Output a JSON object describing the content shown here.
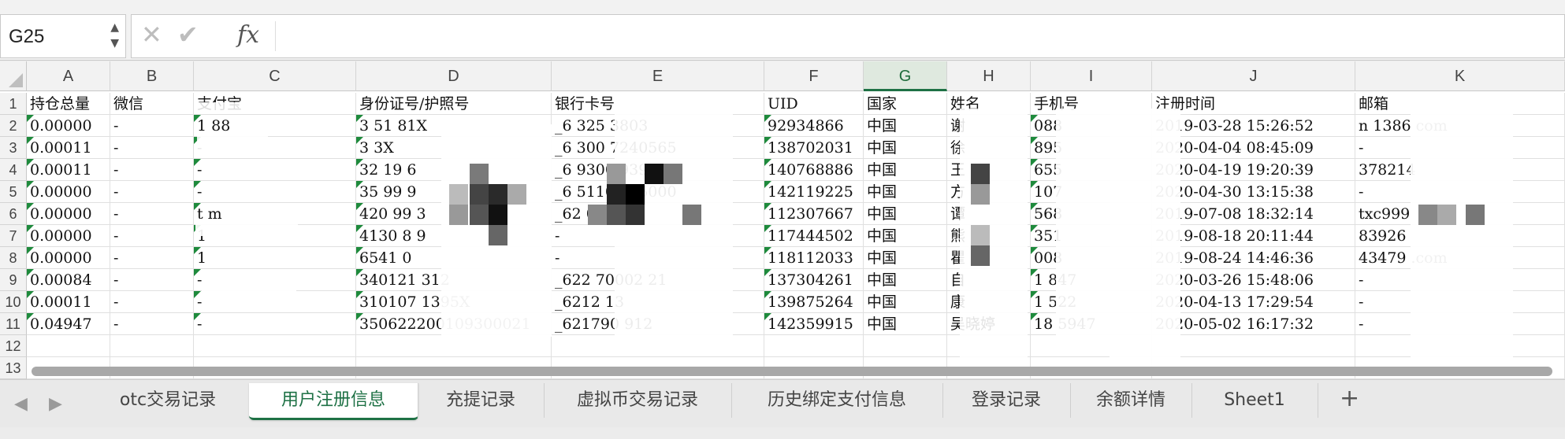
{
  "formula_bar": {
    "cell_ref": "G25",
    "stepper_up": "▲",
    "stepper_down": "▼",
    "cancel": "✕",
    "confirm": "✔",
    "fx": "fx",
    "content": ""
  },
  "columns": [
    "A",
    "B",
    "C",
    "D",
    "E",
    "F",
    "G",
    "H",
    "I",
    "J",
    "K"
  ],
  "active_column": "G",
  "row_numbers": [
    "1",
    "2",
    "3",
    "4",
    "5",
    "6",
    "7",
    "8",
    "9",
    "10",
    "11",
    "12",
    "13"
  ],
  "headers": [
    "持仓总量",
    "微信",
    "支付宝",
    "身份证号/护照号",
    "银行卡号",
    "UID",
    "国家",
    "姓名",
    "手机号",
    "注册时间",
    "邮箱"
  ],
  "rows": [
    [
      "0.00000",
      "-",
      "1         88",
      "3    51        81X",
      "_6    325    3803",
      "92934866",
      "中国",
      "谢",
      "         088",
      "2019-03-28 15:26:52",
      "n        1386     com"
    ],
    [
      "0.00011",
      "-",
      "-",
      "3              3X",
      "_6    300    7240565",
      "138702031",
      "中国",
      "徐",
      "         895",
      "2020-04-04 08:45:09",
      "-"
    ],
    [
      "0.00011",
      "-",
      "-",
      "32    19       6",
      "_6    9300    93906",
      "140768886",
      "中国",
      "王",
      "         655",
      "2020-04-19 19:20:39",
      "378214"
    ],
    [
      "0.00000",
      "-",
      "-",
      "35    99       9",
      "_6    511084    5000",
      "142119225",
      "中国",
      "方",
      "         107",
      "2020-04-30 13:15:38",
      "-"
    ],
    [
      "0.00000",
      "-",
      "t              m",
      "420    99       3",
      "_62    05011",
      "112307667",
      "中国",
      "谭",
      "         568",
      "2019-07-08 18:32:14",
      "txc999"
    ],
    [
      "0.00000",
      "-",
      "1",
      "4130    8       9",
      "-",
      "117444502",
      "中国",
      "熊",
      "         351",
      "2019-08-18 20:11:44",
      "83926"
    ],
    [
      "0.00000",
      "-",
      "1",
      "6541           0",
      "-",
      "118112033",
      "中国",
      "瞿",
      "         008",
      "2019-08-24 14:46:36",
      "43479       .com"
    ],
    [
      "0.00084",
      "-",
      "-",
      "340121        312",
      "_622    70002    21",
      "137304261",
      "中国",
      "自",
      "1        847",
      "2020-03-26 15:48:06",
      "-"
    ],
    [
      "0.00011",
      "-",
      "-",
      "310107       1395X",
      "_6212          13",
      "139875264",
      "中国",
      "康",
      "1        522",
      "2020-04-13 17:29:54",
      "-"
    ],
    [
      "0.04947",
      "-",
      "-",
      "350622200109300021",
      "_621790        912",
      "142359915",
      "中国",
      "吴晓婷",
      "18        5947",
      "2020-05-02 16:17:32",
      "-"
    ]
  ],
  "tabs": [
    "otc交易记录",
    "用户注册信息",
    "充提记录",
    "虚拟币交易记录",
    "历史绑定支付信息",
    "登录记录",
    "余额详情",
    "Sheet1"
  ],
  "active_tab": "用户注册信息",
  "add_tab": "+",
  "nav_prev": "◀",
  "nav_next": "▶",
  "colors": {
    "accent": "#1e7145",
    "comment_triangle": "#1e8a3c"
  }
}
